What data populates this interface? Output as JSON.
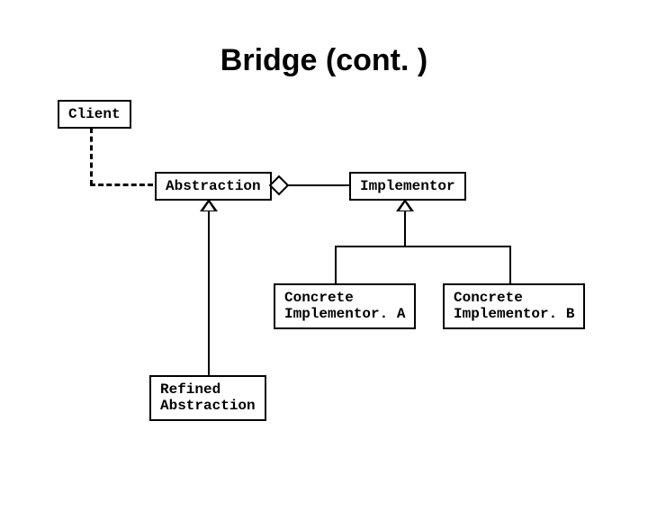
{
  "title": "Bridge (cont. )",
  "boxes": {
    "client": "Client",
    "abstraction": "Abstraction",
    "implementor": "Implementor",
    "concreteA": "Concrete\nImplementor. A",
    "concreteB": "Concrete\nImplementor. B",
    "refined": "Refined\nAbstraction"
  }
}
